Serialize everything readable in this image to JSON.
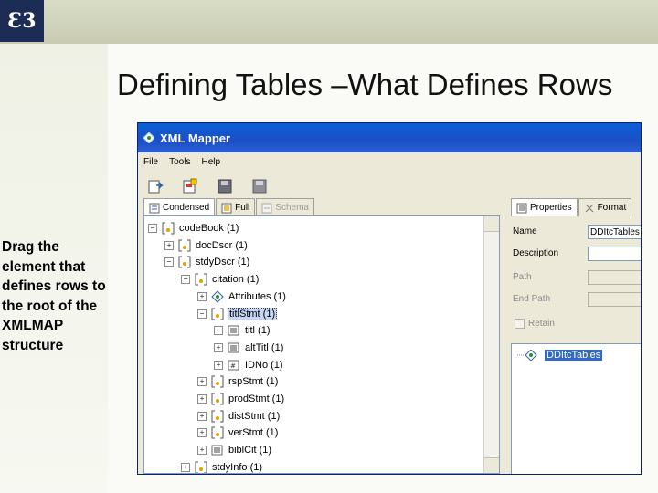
{
  "slide": {
    "logo_text": "Ɛ3",
    "title": "Defining Tables –What Defines Rows",
    "side_note": "Drag the element that defines rows to the root of the XMLMAP structure"
  },
  "window": {
    "title": "XML Mapper",
    "menu": [
      "File",
      "Tools",
      "Help"
    ],
    "toolbar_icons": [
      "open-icon",
      "save-map-icon",
      "disk-icon",
      "disk-disabled-icon"
    ],
    "left_tabs": [
      {
        "label": "Condensed",
        "icon": "condensed-icon",
        "state": "active"
      },
      {
        "label": "Full",
        "icon": "full-icon",
        "state": "normal"
      },
      {
        "label": "Schema",
        "icon": "schema-icon",
        "state": "disabled"
      }
    ],
    "right_tabs": [
      {
        "label": "Properties",
        "icon": "properties-icon",
        "state": "active"
      },
      {
        "label": "Format",
        "icon": "format-icon",
        "state": "normal"
      }
    ],
    "tree": [
      {
        "label": "codeBook (1)",
        "expander": "−",
        "icon": "element-icon"
      },
      {
        "label": "docDscr (1)",
        "expander": "+",
        "icon": "element-icon"
      },
      {
        "label": "stdyDscr (1)",
        "expander": "−",
        "icon": "element-icon"
      },
      {
        "label": "citation (1)",
        "expander": "−",
        "icon": "element-icon"
      },
      {
        "label": "Attributes (1)",
        "expander": "+",
        "icon": "attributes-icon"
      },
      {
        "label": "titlStmt (1)",
        "expander": "−",
        "icon": "element-icon",
        "selected": true
      },
      {
        "label": "titl (1)",
        "expander": "−",
        "icon": "text-node-icon"
      },
      {
        "label": "altTitl (1)",
        "expander": "+",
        "icon": "text-node-icon"
      },
      {
        "label": "IDNo (1)",
        "expander": "+",
        "icon": "id-node-icon"
      },
      {
        "label": "rspStmt (1)",
        "expander": "+",
        "icon": "element-icon"
      },
      {
        "label": "prodStmt (1)",
        "expander": "+",
        "icon": "element-icon"
      },
      {
        "label": "distStmt (1)",
        "expander": "+",
        "icon": "element-icon"
      },
      {
        "label": "verStmt (1)",
        "expander": "+",
        "icon": "element-icon"
      },
      {
        "label": "biblCit (1)",
        "expander": "+",
        "icon": "text-node-icon"
      },
      {
        "label": "stdyInfo (1)",
        "expander": "+",
        "icon": "element-icon"
      }
    ],
    "properties": {
      "name_label": "Name",
      "name_value": "DDItcTables",
      "description_label": "Description",
      "description_value": "",
      "path_label": "Path",
      "path_value": "",
      "end_path_label": "End Path",
      "end_path_value": "",
      "retain_label": "Retain"
    },
    "tables": [
      {
        "label": "DDItcTables",
        "icon": "tables-icon"
      }
    ]
  },
  "colors": {
    "title_bar": "#0a5fd6",
    "selection": "#316ac5",
    "window_bg": "#ece9d8",
    "logo_bg": "#1c2c55"
  }
}
